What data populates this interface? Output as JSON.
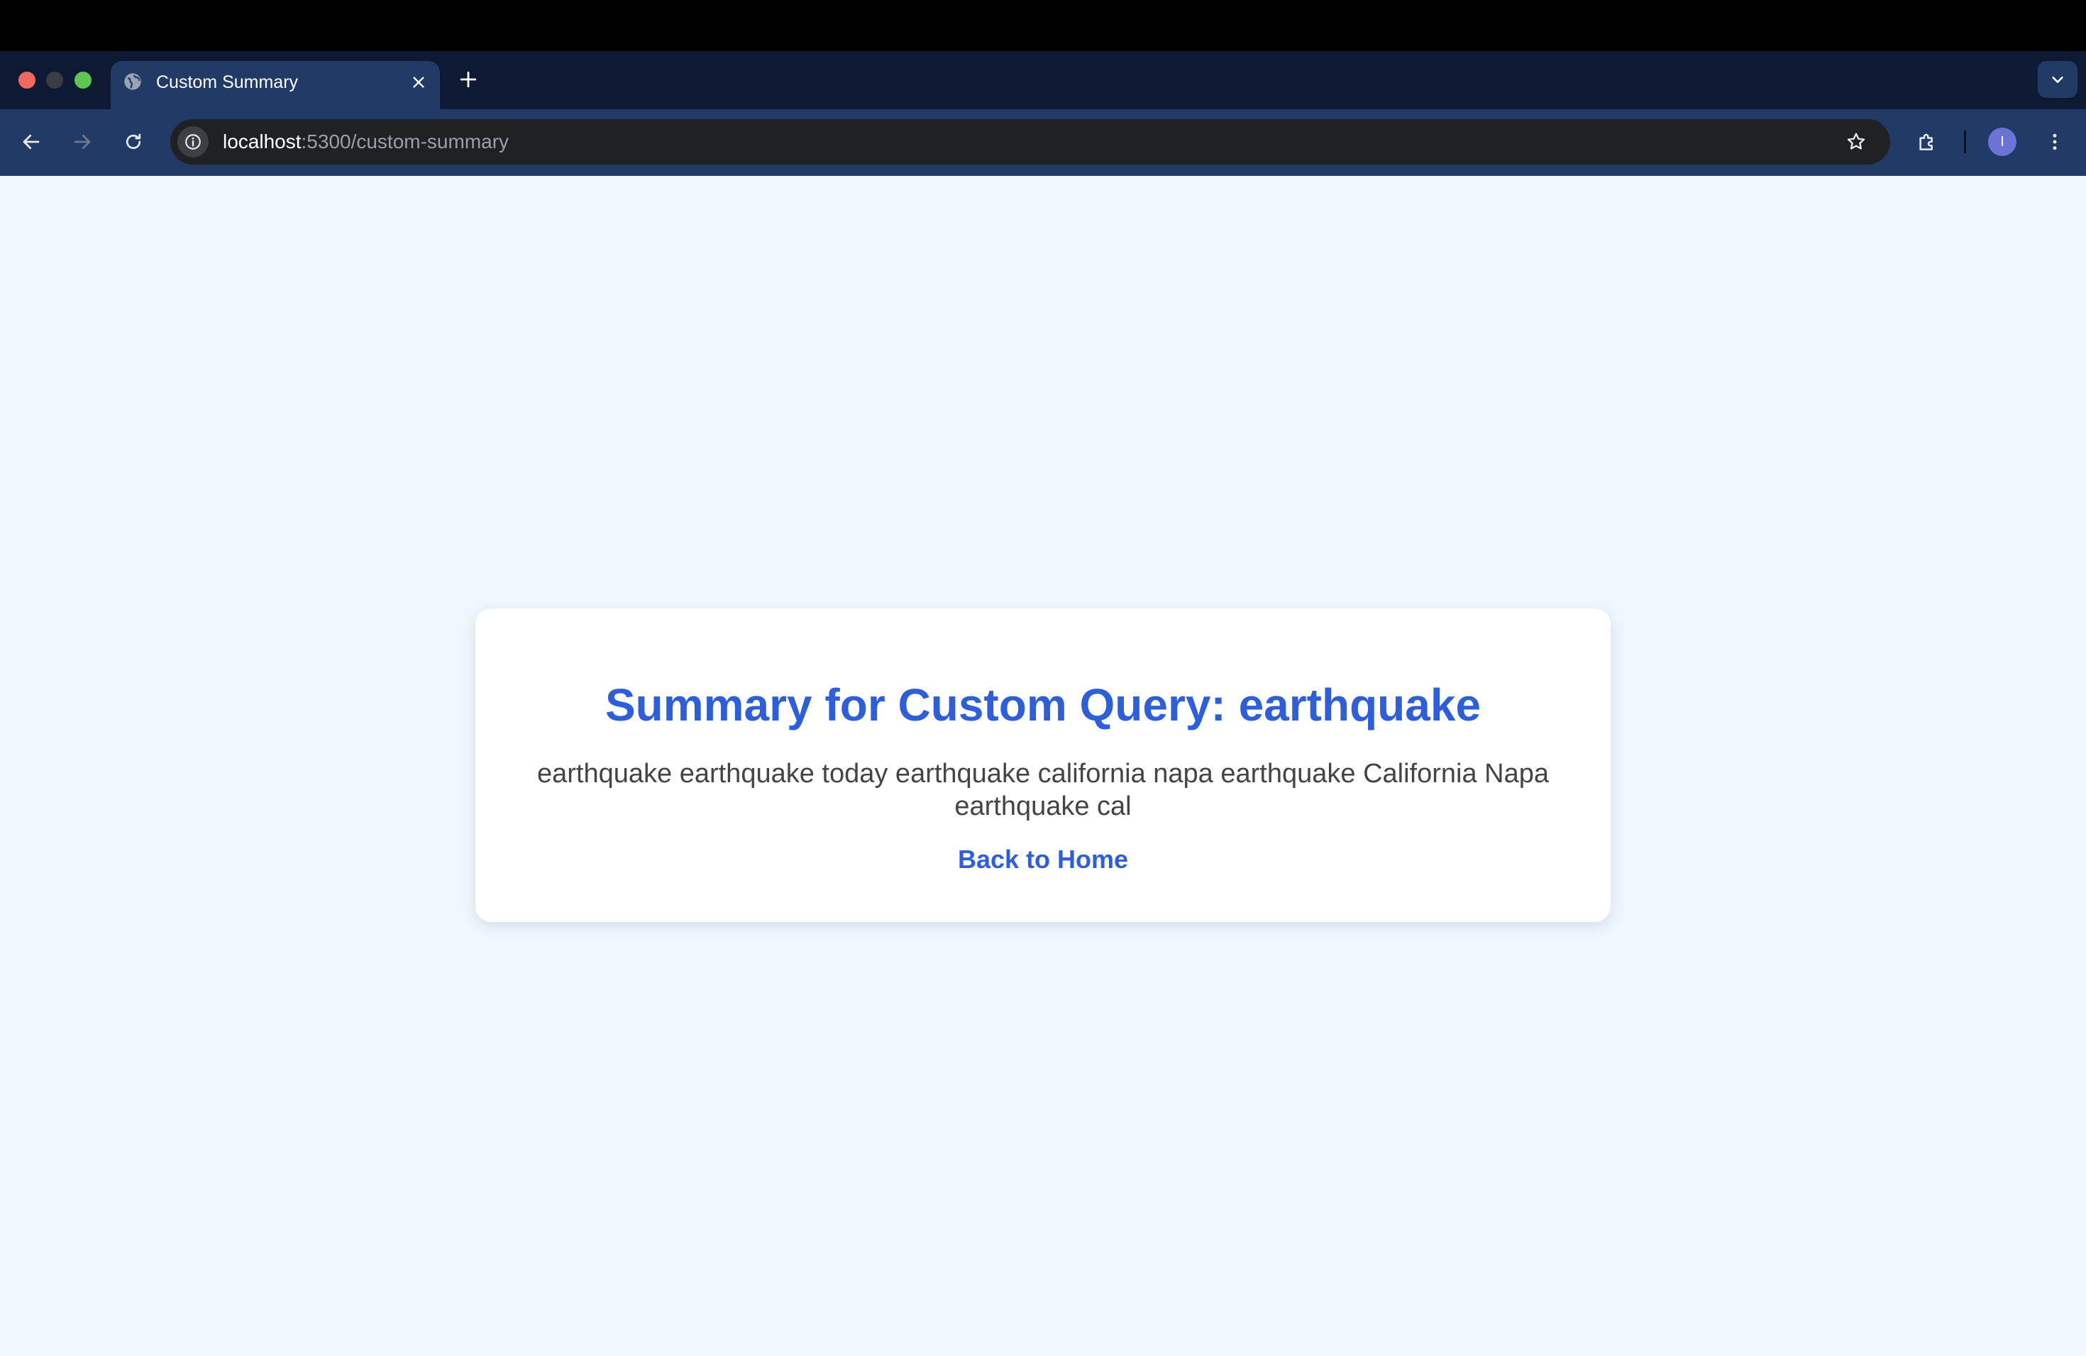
{
  "browser": {
    "tab_title": "Custom Summary",
    "url_host": "localhost",
    "url_path": ":5300/custom-summary",
    "avatar_initial": "I",
    "icons": {
      "favicon": "globe-icon",
      "close": "close-icon",
      "new_tab": "plus-icon",
      "tab_menu": "chevron-down-icon",
      "back": "arrow-left-icon",
      "forward": "arrow-right-icon",
      "reload": "reload-icon",
      "site_info": "info-icon",
      "bookmark": "star-icon",
      "extensions": "puzzle-icon",
      "menu": "kebab-menu-icon"
    }
  },
  "page": {
    "title": "Summary for Custom Query: earthquake",
    "summary": "earthquake earthquake today earthquake california napa earthquake California Napa earthquake cal",
    "back_link": "Back to Home"
  },
  "colors": {
    "accent": "#2f5fd8",
    "page_background": "#eff7fe",
    "text": "#444444"
  }
}
